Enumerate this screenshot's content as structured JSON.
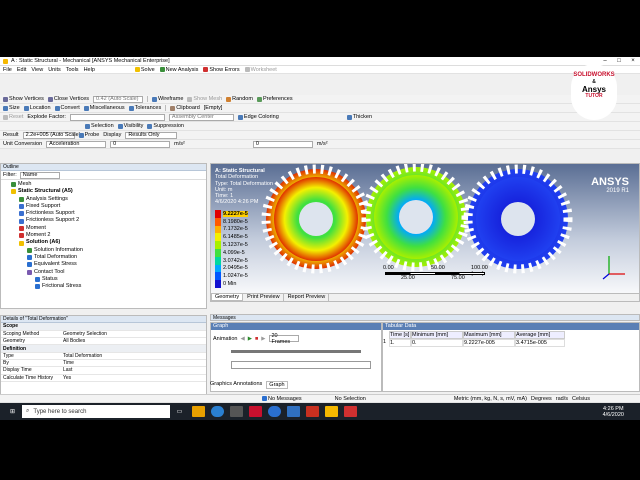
{
  "window": {
    "title": "A : Static Structural - Mechanical [ANSYS Mechanical Enterprise]"
  },
  "menu": [
    "File",
    "Edit",
    "View",
    "Units",
    "Tools",
    "Help"
  ],
  "toolbar1": {
    "solve": "Solve",
    "new_analysis": "New Analysis",
    "show_errors": "Show Errors",
    "worksheet": "Worksheet"
  },
  "toolbar2": {
    "show_vertices": "Show Vertices",
    "close_vertices": "Close Vertices",
    "auto_scale": "0.42 (Auto Scale)",
    "wireframe": "Wireframe",
    "show_mesh": "Show Mesh",
    "random": "Random",
    "preferences": "Preferences"
  },
  "toolbar3": {
    "size": "Size",
    "location": "Location",
    "convert": "Convert",
    "miscellaneous": "Miscellaneous",
    "tolerances": "Tolerances",
    "clipboard": "Clipboard",
    "empty": "[Empty]"
  },
  "toolbar4": {
    "reset": "Reset",
    "explode_factor": "Explode Factor:",
    "assembly_center": "Assembly Center",
    "edge_coloring": "Edge Coloring",
    "thicken": "Thicken"
  },
  "toolbar5": {
    "selection": "Selection",
    "visibility": "Visibility",
    "suppression": "Suppression"
  },
  "toolbar6": {
    "result": "Result",
    "result_scale": "2.2e+005 (Auto Scale)",
    "probe": "Probe",
    "display": "Display",
    "results_only": "Results Only"
  },
  "toolbar7": {
    "unit_conversion": "Unit Conversion",
    "acceleration": "Acceleration",
    "zero1": "0",
    "unit1": "m/s²",
    "zero2": "0",
    "unit2": "m/s²"
  },
  "outline": {
    "title": "Outline",
    "filter_label": "Filter:",
    "filter_value": "Name",
    "items": [
      {
        "label": "Mesh"
      },
      {
        "label": "Static Structural (A5)"
      },
      {
        "label": "Analysis Settings"
      },
      {
        "label": "Fixed Support"
      },
      {
        "label": "Frictionless Support"
      },
      {
        "label": "Frictionless Support 2"
      },
      {
        "label": "Moment"
      },
      {
        "label": "Moment 2"
      },
      {
        "label": "Solution (A6)"
      },
      {
        "label": "Solution Information"
      },
      {
        "label": "Total Deformation"
      },
      {
        "label": "Equivalent Stress"
      },
      {
        "label": "Contact Tool"
      },
      {
        "label": "Status"
      },
      {
        "label": "Frictional Stress"
      }
    ]
  },
  "details": {
    "title": "Details of \"Total Deformation\"",
    "rows": [
      {
        "k": "Scope",
        "v": "",
        "group": true
      },
      {
        "k": "Scoping Method",
        "v": "Geometry Selection"
      },
      {
        "k": "Geometry",
        "v": "All Bodies"
      },
      {
        "k": "Definition",
        "v": "",
        "group": true
      },
      {
        "k": "Type",
        "v": "Total Deformation"
      },
      {
        "k": "By",
        "v": "Time"
      },
      {
        "k": "Display Time",
        "v": "Last"
      },
      {
        "k": "Calculate Time History",
        "v": "Yes"
      }
    ]
  },
  "viewport": {
    "result_title": "A: Static Structural",
    "result_name": "Total Deformation",
    "result_type": "Type: Total Deformation",
    "unit": "Unit: m",
    "time": "Time: 1",
    "date": "4/6/2020 4:26 PM",
    "legend": [
      "9.2227e-5",
      "8.1980e-5",
      "7.1732e-5",
      "6.1485e-5",
      "5.1237e-5",
      "4.099e-5",
      "3.0742e-5",
      "2.0495e-5",
      "1.0247e-5",
      "0 Min"
    ],
    "legend_colors": [
      "#e00000",
      "#ff5a00",
      "#ffb000",
      "#f4f000",
      "#a8f000",
      "#40e040",
      "#00d8a0",
      "#00a8ff",
      "#0058ff",
      "#1010d0"
    ],
    "brand": "ANSYS",
    "version": "2019 R1",
    "scale_labels": [
      "0.00",
      "50.00",
      "100.00 (mm)",
      "25.00",
      "75.00"
    ],
    "tabs": [
      "Geometry",
      "Print Preview",
      "Report Preview"
    ]
  },
  "messages_title": "Messages",
  "graph": {
    "title": "Graph",
    "animation": "Animation",
    "frames": "20 Frames",
    "tabs": [
      "Graphics Annotations",
      "Graph"
    ]
  },
  "tabular": {
    "title": "Tabular Data",
    "headers": [
      "Time [s]",
      "Minimum [mm]",
      "Maximum [mm]",
      "Average [mm]"
    ],
    "row": [
      "1",
      "1.",
      "0.",
      "9.2227e-005",
      "3.4715e-005"
    ]
  },
  "statusbar": {
    "messages": "No Messages",
    "selection": "No Selection",
    "units": "Metric (mm, kg, N, s, mV, mA)",
    "degrees": "Degrees",
    "rads": "rad/s",
    "celsius": "Celsius"
  },
  "watermark": {
    "line1": "SOLIDWORKS",
    "line2": "&",
    "line3": "Ansys",
    "line4": "TUTOR"
  },
  "taskbar": {
    "search": "Type here to search",
    "time": "4:26 PM",
    "date": "4/6/2020"
  }
}
